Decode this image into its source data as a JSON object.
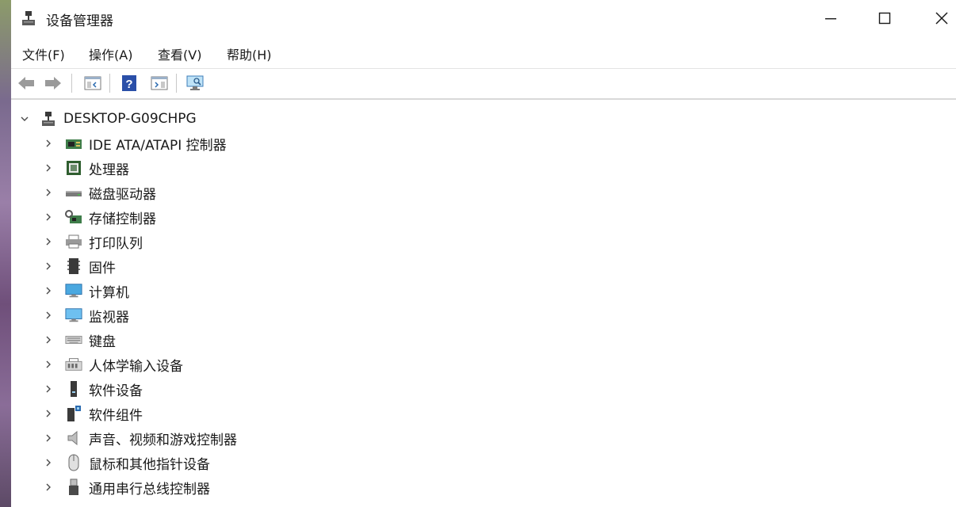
{
  "window": {
    "title": "设备管理器"
  },
  "menu": {
    "items": [
      "文件(F)",
      "操作(A)",
      "查看(V)",
      "帮助(H)"
    ]
  },
  "tree": {
    "root": "DESKTOP-G09CHPG",
    "items": [
      {
        "label": "IDE ATA/ATAPI 控制器",
        "icon": "ide-controller-icon"
      },
      {
        "label": "处理器",
        "icon": "processor-icon"
      },
      {
        "label": "磁盘驱动器",
        "icon": "disk-drive-icon"
      },
      {
        "label": "存储控制器",
        "icon": "storage-controller-icon"
      },
      {
        "label": "打印队列",
        "icon": "print-queue-icon"
      },
      {
        "label": "固件",
        "icon": "firmware-icon"
      },
      {
        "label": "计算机",
        "icon": "computer-icon"
      },
      {
        "label": "监视器",
        "icon": "monitor-icon"
      },
      {
        "label": "键盘",
        "icon": "keyboard-icon"
      },
      {
        "label": "人体学输入设备",
        "icon": "hid-icon"
      },
      {
        "label": "软件设备",
        "icon": "software-device-icon"
      },
      {
        "label": "软件组件",
        "icon": "software-component-icon"
      },
      {
        "label": "声音、视频和游戏控制器",
        "icon": "sound-icon"
      },
      {
        "label": "鼠标和其他指针设备",
        "icon": "mouse-icon"
      },
      {
        "label": "通用串行总线控制器",
        "icon": "usb-icon"
      }
    ]
  }
}
